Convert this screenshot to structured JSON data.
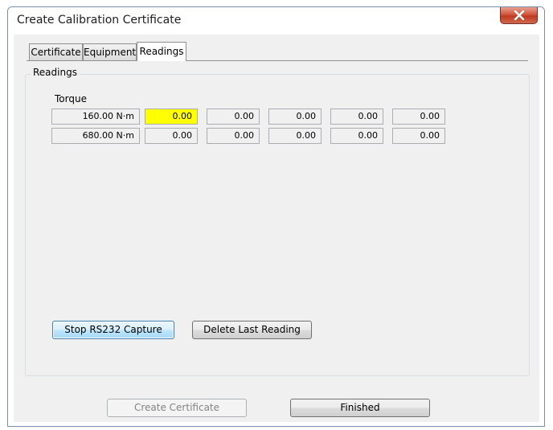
{
  "window": {
    "title": "Create Calibration Certificate"
  },
  "tabs": [
    {
      "label": "Certificate",
      "active": false
    },
    {
      "label": "Equipment",
      "active": false
    },
    {
      "label": "Readings",
      "active": true
    }
  ],
  "readings": {
    "group_label": "Readings",
    "column_label": "Torque",
    "rows": [
      {
        "nominal": "160.00 N·m",
        "values": [
          "0.00",
          "0.00",
          "0.00",
          "0.00",
          "0.00"
        ]
      },
      {
        "nominal": "680.00 N·m",
        "values": [
          "0.00",
          "0.00",
          "0.00",
          "0.00",
          "0.00"
        ]
      }
    ],
    "highlight_color": "#ffff00"
  },
  "actions": {
    "stop_capture": "Stop RS232 Capture",
    "delete_last": "Delete Last Reading"
  },
  "footer": {
    "create_certificate": "Create Certificate",
    "finished": "Finished"
  }
}
